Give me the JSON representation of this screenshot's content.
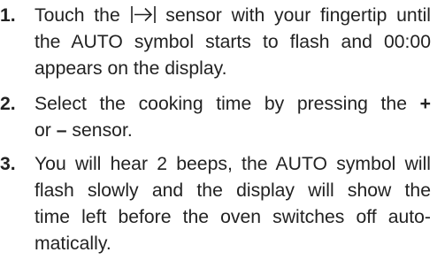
{
  "steps": [
    {
      "number": "1.",
      "lines": [
        {
          "before": "Touch the ",
          "icon": "arrow-to-bar-icon",
          "after": " sensor with your fingertip until"
        },
        {
          "text": "the AUTO symbol starts to flash and 00:00"
        },
        {
          "text": "appears on the display."
        }
      ]
    },
    {
      "number": "2.",
      "lines": [
        {
          "before": "Select the cooking time by pressing the ",
          "plus": "+"
        },
        {
          "before": "or ",
          "minus": "–",
          "after": " sensor."
        }
      ]
    },
    {
      "number": "3.",
      "lines": [
        {
          "text": "You will hear 2 beeps, the AUTO symbol will"
        },
        {
          "text": "flash slowly and the display will show the"
        },
        {
          "text": "time left before the oven switches off auto-"
        },
        {
          "text": "matically."
        }
      ]
    }
  ]
}
